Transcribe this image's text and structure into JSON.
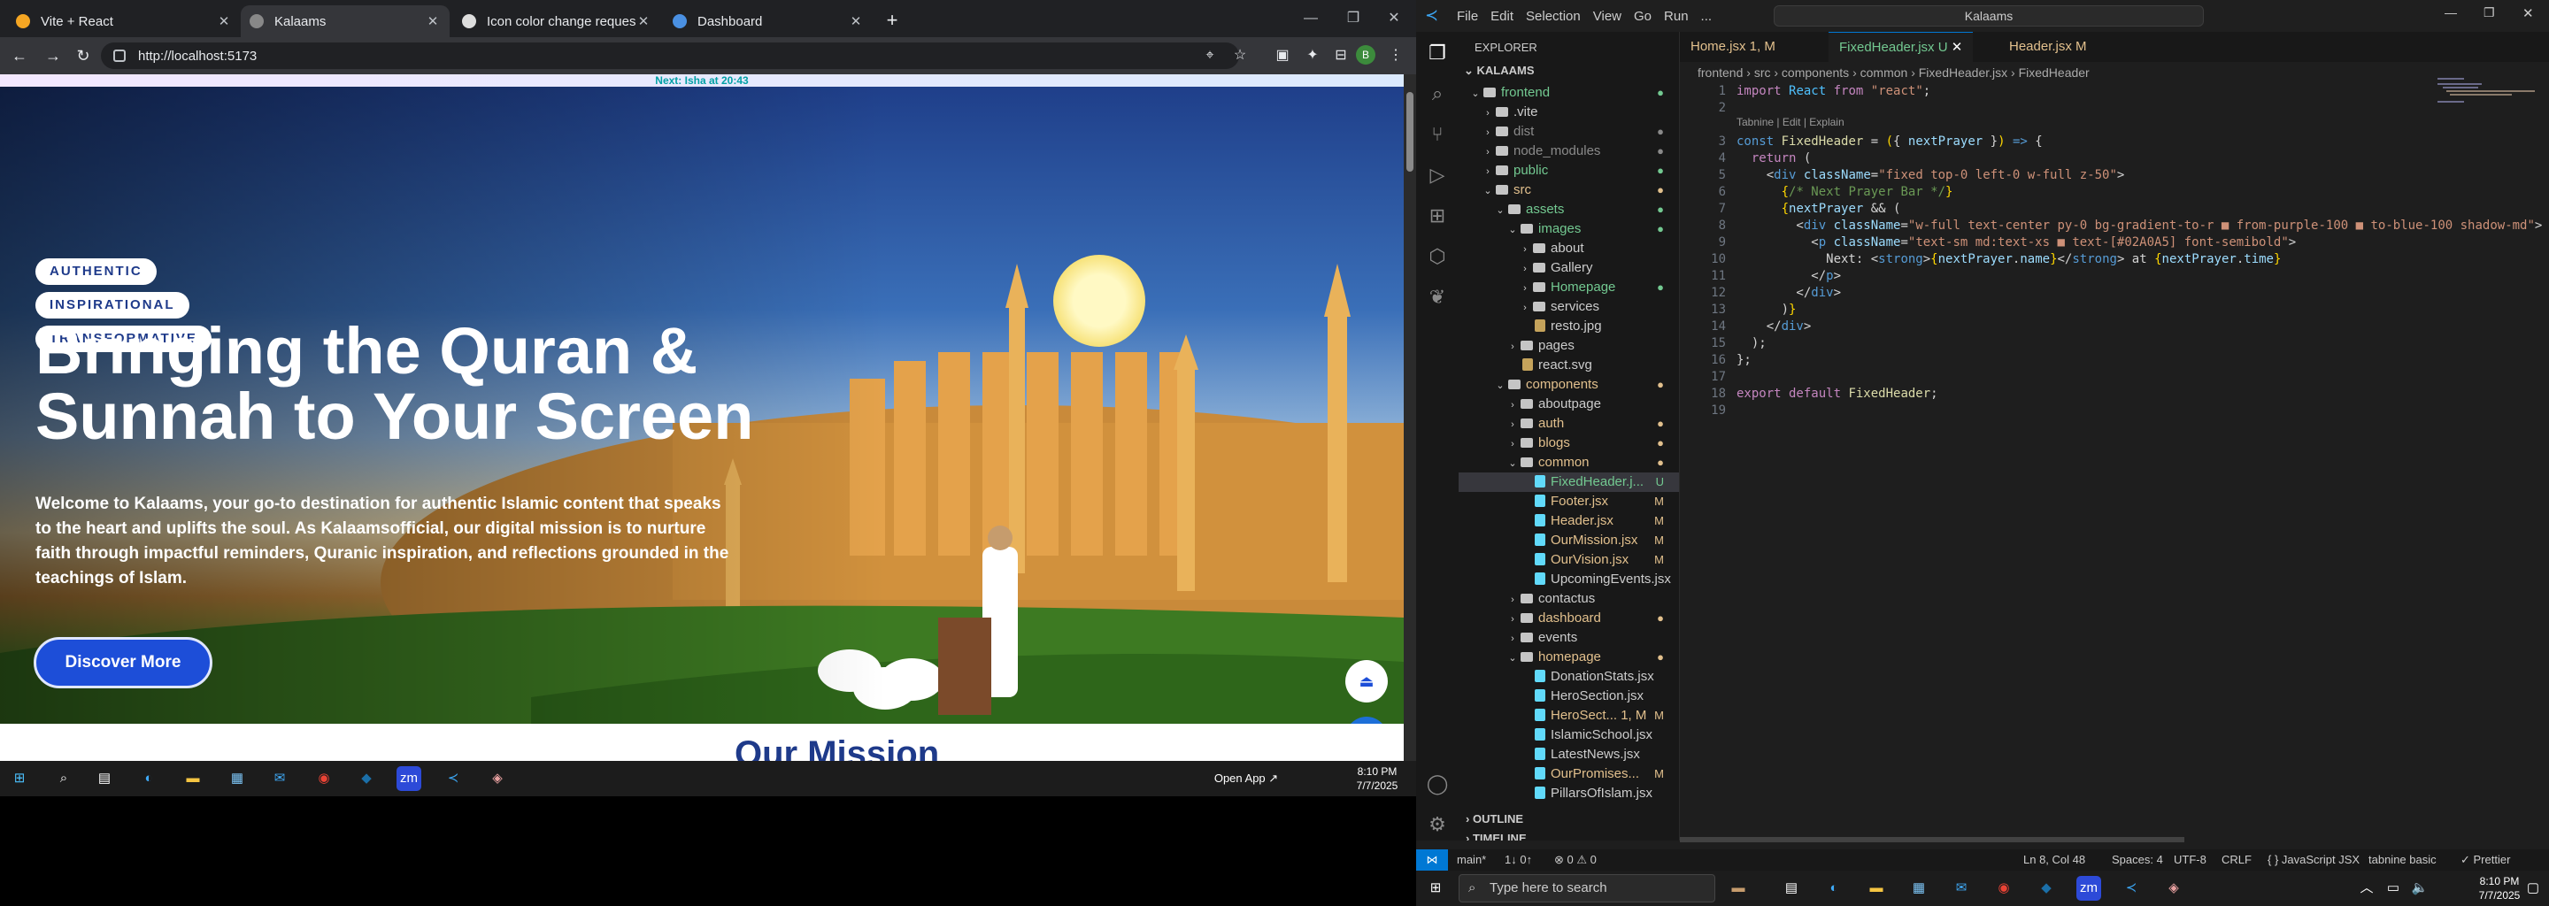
{
  "chrome": {
    "tabs": [
      {
        "label": "Vite + React",
        "icon_color": "#f5a623"
      },
      {
        "label": "Kalaams",
        "icon_color": "#888888"
      },
      {
        "label": "Icon color change request",
        "icon_color": "#dddddd"
      },
      {
        "label": "Dashboard",
        "icon_color": "#4a90e2"
      }
    ],
    "url": "http://localhost:5173",
    "profile_initial": "B"
  },
  "page": {
    "prayer_next_label": "Next:",
    "prayer_name": "Isha",
    "prayer_at": "at 20:43",
    "pills": [
      "AUTHENTIC",
      "INSPIRATIONAL",
      "TRANSFORMATIVE"
    ],
    "hero_title": "Bringing the Quran & Sunnah to Your Screen",
    "hero_desc": "Welcome to Kalaams, your go-to destination for authentic Islamic content that speaks to the heart and uplifts the soul. As Kalaamsofficial, our digital mission is to nurture faith through impactful reminders, Quranic inspiration, and reflections grounded in the teachings of Islam.",
    "discover_label": "Discover More",
    "below_heading": "Our Mission"
  },
  "taskbar_left": {
    "open_app": "Open App ↗",
    "time": "8:10 PM",
    "date": "7/7/2025"
  },
  "vscode": {
    "menu": [
      "File",
      "Edit",
      "Selection",
      "View",
      "Go",
      "Run",
      "..."
    ],
    "command_center": "Kalaams",
    "explorer_label": "EXPLORER",
    "project": "KALAAMS",
    "tree": [
      {
        "label": "frontend",
        "type": "folder",
        "depth": 0,
        "open": true,
        "color": "#73c991"
      },
      {
        "label": ".vite",
        "type": "folder",
        "depth": 1
      },
      {
        "label": "dist",
        "type": "folder",
        "depth": 1,
        "color": "#8a8a8a"
      },
      {
        "label": "node_modules",
        "type": "folder",
        "depth": 1,
        "color": "#8a8a8a"
      },
      {
        "label": "public",
        "type": "folder",
        "depth": 1,
        "color": "#73c991"
      },
      {
        "label": "src",
        "type": "folder",
        "depth": 1,
        "open": true,
        "color": "#e2c08d"
      },
      {
        "label": "assets",
        "type": "folder",
        "depth": 2,
        "open": true,
        "color": "#73c991"
      },
      {
        "label": "images",
        "type": "folder",
        "depth": 3,
        "open": true,
        "color": "#73c991"
      },
      {
        "label": "about",
        "type": "folder",
        "depth": 4
      },
      {
        "label": "Gallery",
        "type": "folder",
        "depth": 4
      },
      {
        "label": "Homepage",
        "type": "folder",
        "depth": 4,
        "color": "#73c991"
      },
      {
        "label": "services",
        "type": "folder",
        "depth": 4
      },
      {
        "label": "resto.jpg",
        "type": "file",
        "depth": 4
      },
      {
        "label": "pages",
        "type": "folder",
        "depth": 3
      },
      {
        "label": "react.svg",
        "type": "file",
        "depth": 3
      },
      {
        "label": "components",
        "type": "folder",
        "depth": 2,
        "open": true,
        "color": "#e2c08d"
      },
      {
        "label": "aboutpage",
        "type": "folder",
        "depth": 3
      },
      {
        "label": "auth",
        "type": "folder",
        "depth": 3,
        "color": "#e2c08d"
      },
      {
        "label": "blogs",
        "type": "folder",
        "depth": 3,
        "color": "#e2c08d"
      },
      {
        "label": "common",
        "type": "folder",
        "depth": 3,
        "open": true,
        "color": "#e2c08d"
      },
      {
        "label": "FixedHeader.j...",
        "type": "file",
        "depth": 4,
        "badge": "U",
        "color": "#73c991",
        "selected": true
      },
      {
        "label": "Footer.jsx",
        "type": "file",
        "depth": 4,
        "badge": "M",
        "color": "#e2c08d"
      },
      {
        "label": "Header.jsx",
        "type": "file",
        "depth": 4,
        "badge": "M",
        "color": "#e2c08d"
      },
      {
        "label": "OurMission.jsx",
        "type": "file",
        "depth": 4,
        "badge": "M",
        "color": "#e2c08d"
      },
      {
        "label": "OurVision.jsx",
        "type": "file",
        "depth": 4,
        "badge": "M",
        "color": "#e2c08d"
      },
      {
        "label": "UpcomingEvents.jsx",
        "type": "file",
        "depth": 4
      },
      {
        "label": "contactus",
        "type": "folder",
        "depth": 3
      },
      {
        "label": "dashboard",
        "type": "folder",
        "depth": 3,
        "color": "#e2c08d"
      },
      {
        "label": "events",
        "type": "folder",
        "depth": 3
      },
      {
        "label": "homepage",
        "type": "folder",
        "depth": 3,
        "open": true,
        "color": "#e2c08d"
      },
      {
        "label": "DonationStats.jsx",
        "type": "file",
        "depth": 4
      },
      {
        "label": "HeroSection.jsx",
        "type": "file",
        "depth": 4
      },
      {
        "label": "HeroSect... 1, M",
        "type": "file",
        "depth": 4,
        "badge": "M",
        "color": "#e2c08d"
      },
      {
        "label": "IslamicSchool.jsx",
        "type": "file",
        "depth": 4
      },
      {
        "label": "LatestNews.jsx",
        "type": "file",
        "depth": 4
      },
      {
        "label": "OurPromises...",
        "type": "file",
        "depth": 4,
        "badge": "M",
        "color": "#e2c08d"
      },
      {
        "label": "PillarsOfIslam.jsx",
        "type": "file",
        "depth": 4
      }
    ],
    "outline_label": "OUTLINE",
    "timeline_label": "TIMELINE",
    "tabs": [
      {
        "label": "Home.jsx  1, M",
        "active": false,
        "color": "#e2c08d"
      },
      {
        "label": "FixedHeader.jsx  U",
        "active": true,
        "color": "#73c991"
      },
      {
        "label": "Header.jsx  M",
        "active": false,
        "color": "#e2c08d"
      }
    ],
    "breadcrumb": "frontend › src › components › common › FixedHeader.jsx › FixedHeader",
    "codelens": "Tabnine | Edit | Explain",
    "status": {
      "branch": "main*",
      "sync": "1↓ 0↑",
      "problems": "⊗ 0  ⚠ 0",
      "position": "Ln 8, Col 48",
      "spaces": "Spaces: 4",
      "encoding": "UTF-8",
      "eol": "CRLF",
      "language": "{ } JavaScript JSX",
      "tabnine": "tabnine basic",
      "prettier": "✓ Prettier"
    }
  },
  "taskbar_right": {
    "search_placeholder": "Type here to search",
    "time": "8:10 PM",
    "date": "7/7/2025"
  }
}
